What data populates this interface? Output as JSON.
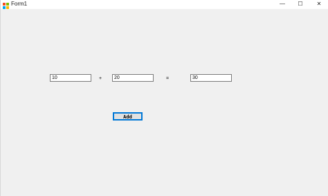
{
  "window": {
    "title": "Form1",
    "app_icon": "winforms-app-icon",
    "caption_buttons": {
      "minimize_glyph": "—",
      "maximize_glyph": "☐",
      "close_glyph": "✕"
    }
  },
  "form": {
    "operand1_value": "10",
    "plus_symbol": "+",
    "operand2_value": "20",
    "equals_symbol": "=",
    "result_value": "30",
    "add_button_label": "Add"
  },
  "colors": {
    "client_background": "#f0f0f0",
    "button_focus_border": "#0078d7"
  }
}
